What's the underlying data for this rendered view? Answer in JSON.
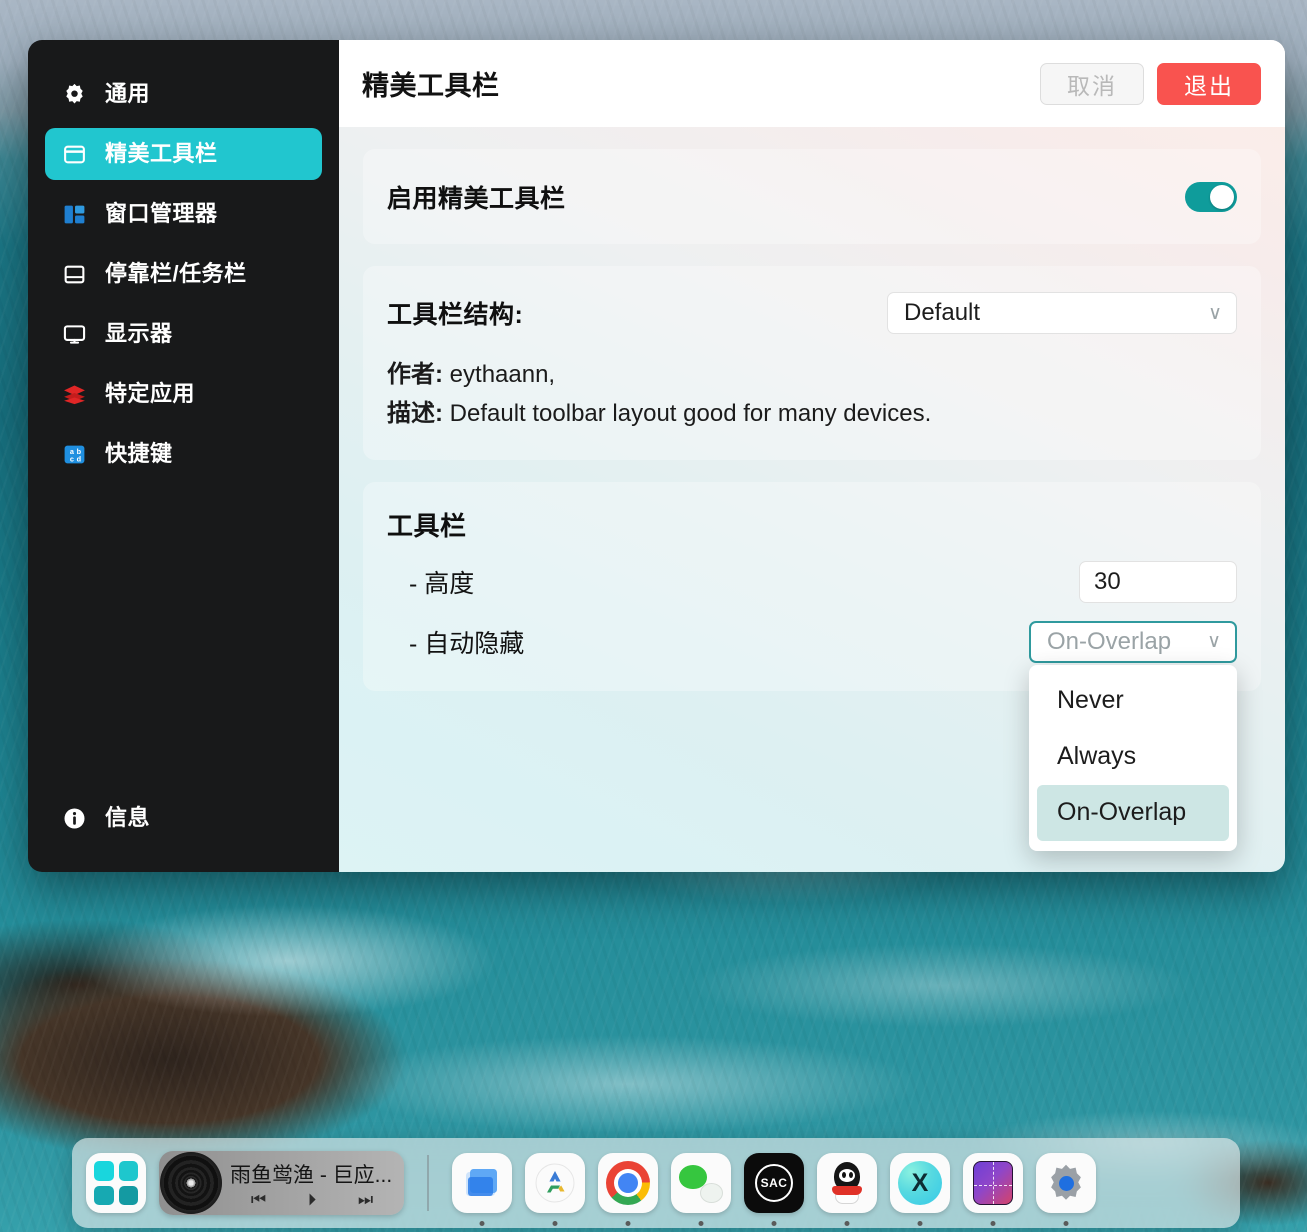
{
  "window": {
    "title": "精美工具栏",
    "buttons": {
      "cancel": "取消",
      "quit": "退出"
    }
  },
  "sidebar": {
    "items": [
      {
        "label": "通用",
        "icon": "gear-icon",
        "active": false
      },
      {
        "label": "精美工具栏",
        "icon": "toolbar-icon",
        "active": true
      },
      {
        "label": "窗口管理器",
        "icon": "window-manager-icon",
        "active": false
      },
      {
        "label": "停靠栏/任务栏",
        "icon": "dock-taskbar-icon",
        "active": false
      },
      {
        "label": "显示器",
        "icon": "monitor-icon",
        "active": false
      },
      {
        "label": "特定应用",
        "icon": "layers-icon",
        "active": false
      },
      {
        "label": "快捷键",
        "icon": "keyboard-shortcut-icon",
        "active": false
      }
    ],
    "bottom": {
      "label": "信息",
      "icon": "info-icon"
    }
  },
  "main": {
    "enable_row": {
      "label": "启用精美工具栏",
      "toggle_on": true
    },
    "structure": {
      "label": "工具栏结构:",
      "selected": "Default",
      "author_label": "作者:",
      "author_value": "eythaann,",
      "desc_label": "描述:",
      "desc_value": "Default toolbar layout good for many devices."
    },
    "toolbar": {
      "section_title": "工具栏",
      "height_label": "- 高度",
      "height_value": "30",
      "autohide_label": "- 自动隐藏",
      "autohide_value": "On-Overlap",
      "autohide_options": [
        "Never",
        "Always",
        "On-Overlap"
      ],
      "autohide_selected_index": 2
    }
  },
  "dock": {
    "launcher": {
      "name": "app-launcher"
    },
    "music": {
      "title": "雨鱼鸴渔 - 巨应...",
      "prev": "◀◀",
      "play": "▶",
      "next": "▶▶"
    },
    "apps": [
      {
        "name": "files-app",
        "glyph": "folder"
      },
      {
        "name": "app-store-app",
        "glyph": "appstore"
      },
      {
        "name": "chrome-app",
        "glyph": "chrome"
      },
      {
        "name": "wechat-app",
        "glyph": "wechat"
      },
      {
        "name": "sac-app",
        "glyph": "sac",
        "label": "SAC"
      },
      {
        "name": "qq-app",
        "glyph": "qq"
      },
      {
        "name": "xmind-app",
        "glyph": "x",
        "label": "X"
      },
      {
        "name": "gradient-app",
        "glyph": "gradient"
      },
      {
        "name": "settings-app",
        "glyph": "gear"
      }
    ]
  },
  "colors": {
    "accent_teal": "#21c6cf",
    "toggle_on": "#0f9c9b",
    "quit_red": "#f9534f",
    "sidebar_bg": "#18191a",
    "menu_selected": "#cde6e4"
  }
}
